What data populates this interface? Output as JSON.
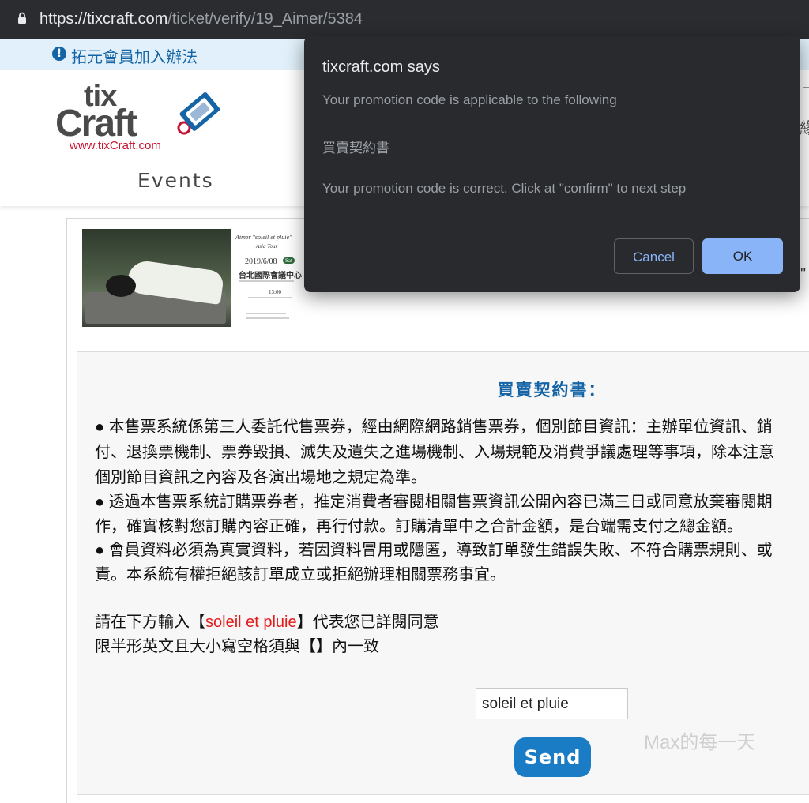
{
  "browser": {
    "url_host": "https://tixcraft.com",
    "url_path": "/ticket/verify/19_Aimer/5384"
  },
  "notice": {
    "text": "拓元會員加入辦法"
  },
  "logo": {
    "url_text": "www.tixCraft.com"
  },
  "nav": {
    "events": "Events"
  },
  "poster_info": {
    "title": "Aimer \"soleil et pluie\"",
    "subtitle": "Asia Tour",
    "date": "2019/6/08",
    "day": "Sat",
    "venue": "台北國際會議中心",
    "time": "13:00"
  },
  "agreement": {
    "title": "買賣契約書：",
    "lines": [
      "● 本售票系統係第三人委託代售票券，經由網際網路銷售票券，個別節目資訊：主辦單位資訊、銷",
      "付、退換票機制、票券毀損、滅失及遺失之進場機制、入場規範及消費爭議處理等事項，除本注意",
      "個別節目資訊之內容及各演出場地之規定為準。",
      "● 透過本售票系統訂購票券者，推定消費者審閱相關售票資訊公開內容已滿三日或同意放棄審閱期",
      "作，確實核對您訂購內容正確，再行付款。訂購清單中之合計金額，是台端需支付之總金額。",
      "● 會員資料必須為真實資料，若因資料冒用或隱匿，導致訂單發生錯誤失敗、不符合購票規則、或",
      "責。本系統有權拒絕該訂單成立或拒絕辦理相關票務事宜。"
    ],
    "instruction_prefix": "請在下方輸入【",
    "instruction_code": "soleil et pluie",
    "instruction_suffix": "】代表您已詳閱同意",
    "instruction_note": "限半形英文且大小寫空格須與【】內一致",
    "input_value": "soleil et pluie",
    "send_label": "Send"
  },
  "watermark": "Max的每一天",
  "dialog": {
    "title": "tixcraft.com says",
    "line1": "Your promotion code is applicable to the following",
    "line2": "買賣契約書",
    "line3": "Your promotion code is correct. Click at \"confirm\" to next step",
    "cancel_label": "Cancel",
    "ok_label": "OK"
  },
  "colors": {
    "dialog_bg": "#292a2d",
    "ok_button": "#8ab4f8",
    "brand_blue": "#1565a6",
    "send_button": "#1a7cc4",
    "accent_red": "#e31b1b"
  }
}
